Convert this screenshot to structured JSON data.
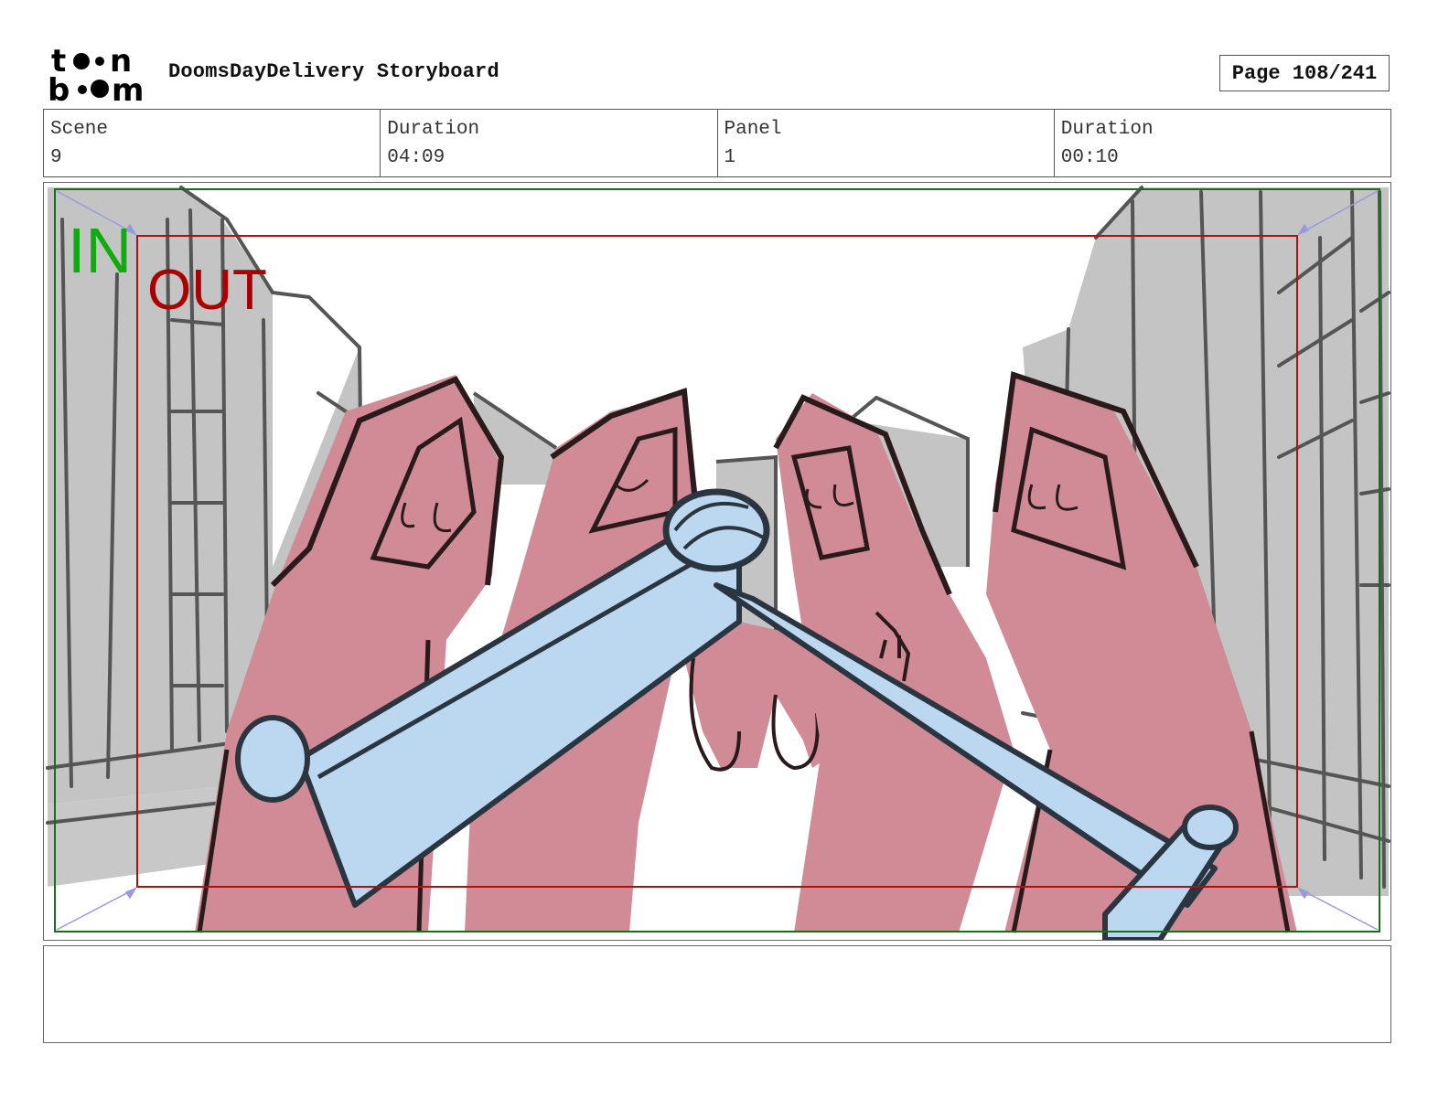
{
  "header": {
    "logo_text_top": "toon",
    "logo_text_bottom": "boom",
    "title": "DoomsDayDelivery Storyboard",
    "page": "Page 108/241"
  },
  "info": [
    {
      "label": "Scene",
      "value": "9"
    },
    {
      "label": "Duration",
      "value": "04:09"
    },
    {
      "label": "Panel",
      "value": "1"
    },
    {
      "label": "Duration",
      "value": "00:10"
    }
  ],
  "panel": {
    "in_label": "IN",
    "out_label": "OUT",
    "colors": {
      "in_frame": "#1a6e1a",
      "out_frame": "#b01010",
      "in_text": "#11aa11",
      "out_text": "#aa0000",
      "robe": "#d08b96",
      "staff": "#bcd8f0",
      "buildings": "#c4c4c4"
    }
  },
  "notes": {
    "text": ""
  }
}
